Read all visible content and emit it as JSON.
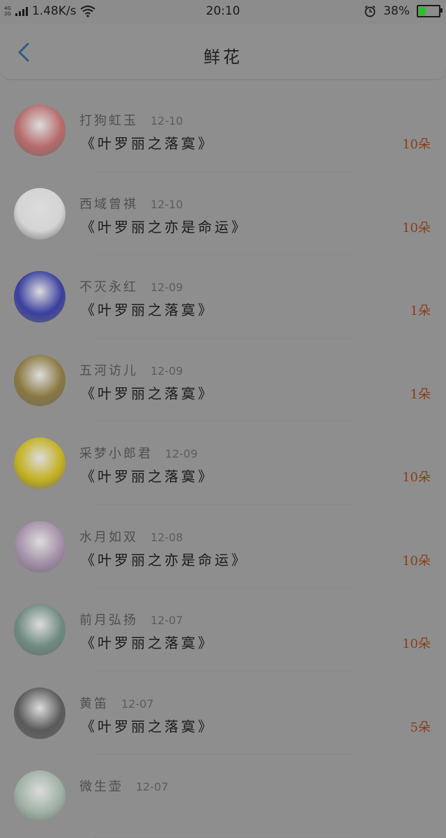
{
  "status_bar": {
    "network": "1.48K/s",
    "time": "20:10",
    "battery": "38%",
    "net_tag_top": "4G",
    "net_tag_bottom": "2G",
    "battery_level": 0.38
  },
  "header": {
    "title": "鲜花"
  },
  "items": [
    {
      "name": "打狗虹玉",
      "date": "12-10",
      "gift": "《叶罗丽之落寞》",
      "count": "10朵",
      "avatar_color": "#b76a6a"
    },
    {
      "name": "西域曾祺",
      "date": "12-10",
      "gift": "《叶罗丽之亦是命运》",
      "count": "10朵",
      "avatar_color": "#d4d4d4"
    },
    {
      "name": "不灭永红",
      "date": "12-09",
      "gift": "《叶罗丽之落寞》",
      "count": "1朵",
      "avatar_color": "#3a3fa0"
    },
    {
      "name": "五河访儿",
      "date": "12-09",
      "gift": "《叶罗丽之落寞》",
      "count": "1朵",
      "avatar_color": "#8a7840"
    },
    {
      "name": "采梦小郎君",
      "date": "12-09",
      "gift": "《叶罗丽之落寞》",
      "count": "10朵",
      "avatar_color": "#c4b020"
    },
    {
      "name": "水月如双",
      "date": "12-08",
      "gift": "《叶罗丽之亦是命运》",
      "count": "10朵",
      "avatar_color": "#a48ea8"
    },
    {
      "name": "前月弘扬",
      "date": "12-07",
      "gift": "《叶罗丽之落寞》",
      "count": "10朵",
      "avatar_color": "#6f8a80"
    },
    {
      "name": "黄笛",
      "date": "12-07",
      "gift": "《叶罗丽之落寞》",
      "count": "5朵",
      "avatar_color": "#5a5a5a"
    },
    {
      "name": "微生壶",
      "date": "12-07",
      "gift": "",
      "count": "",
      "avatar_color": "#9fb0a4"
    }
  ]
}
